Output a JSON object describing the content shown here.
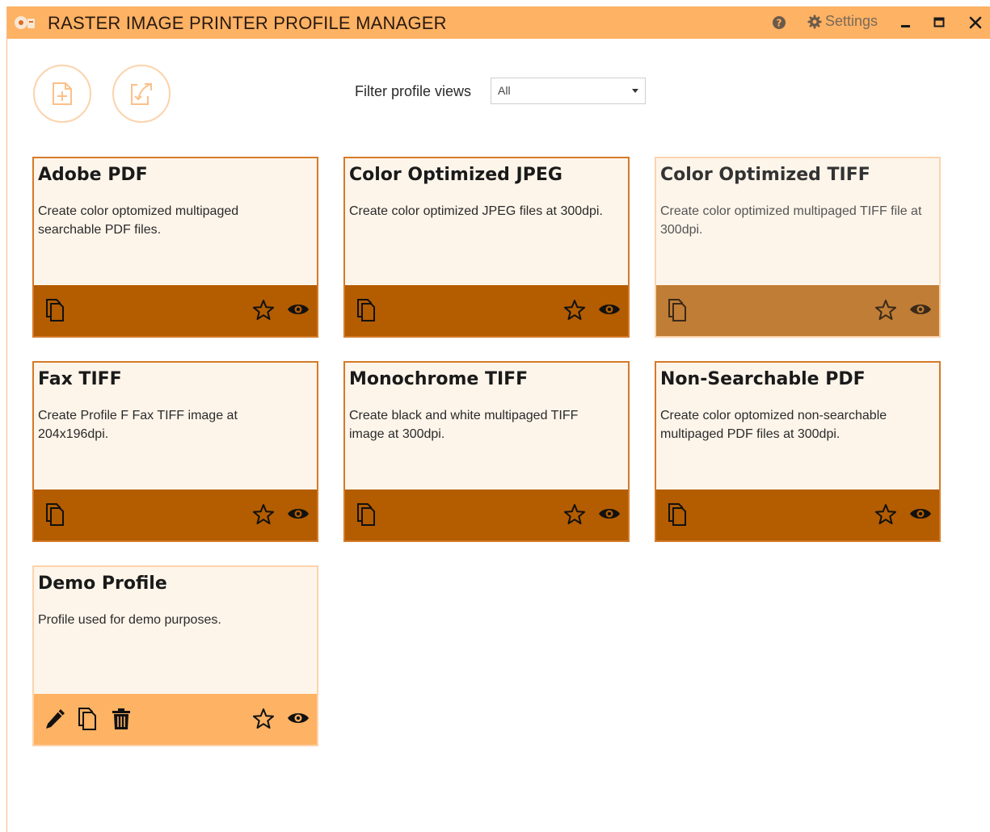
{
  "app": {
    "title": "RASTER IMAGE PRINTER PROFILE MANAGER"
  },
  "titlebar": {
    "settings_label": "Settings"
  },
  "toolbar": {
    "filter_label": "Filter profile views",
    "filter_value": "All"
  },
  "colors": {
    "titlebar_bg": "#fdb264",
    "card_bg": "#fef5ea",
    "footer_dark": "#b35c00",
    "footer_dim": "#c07d35",
    "footer_light": "#fdb264"
  },
  "profiles": [
    {
      "title": "Adobe PDF",
      "description": "Create color optomized multipaged searchable PDF files."
    },
    {
      "title": "Color Optimized JPEG",
      "description": "Create color optimized JPEG files at 300dpi."
    },
    {
      "title": "Color Optimized TIFF",
      "description": "Create color optimized multipaged TIFF file at 300dpi."
    },
    {
      "title": "Fax TIFF",
      "description": "Create Profile F Fax TIFF image at 204x196dpi."
    },
    {
      "title": "Monochrome TIFF",
      "description": "Create black and white multipaged TIFF image at 300dpi."
    },
    {
      "title": "Non-Searchable PDF",
      "description": "Create color optomized non-searchable multipaged PDF files at 300dpi."
    },
    {
      "title": "Demo Profile",
      "description": "Profile used for demo purposes."
    }
  ]
}
